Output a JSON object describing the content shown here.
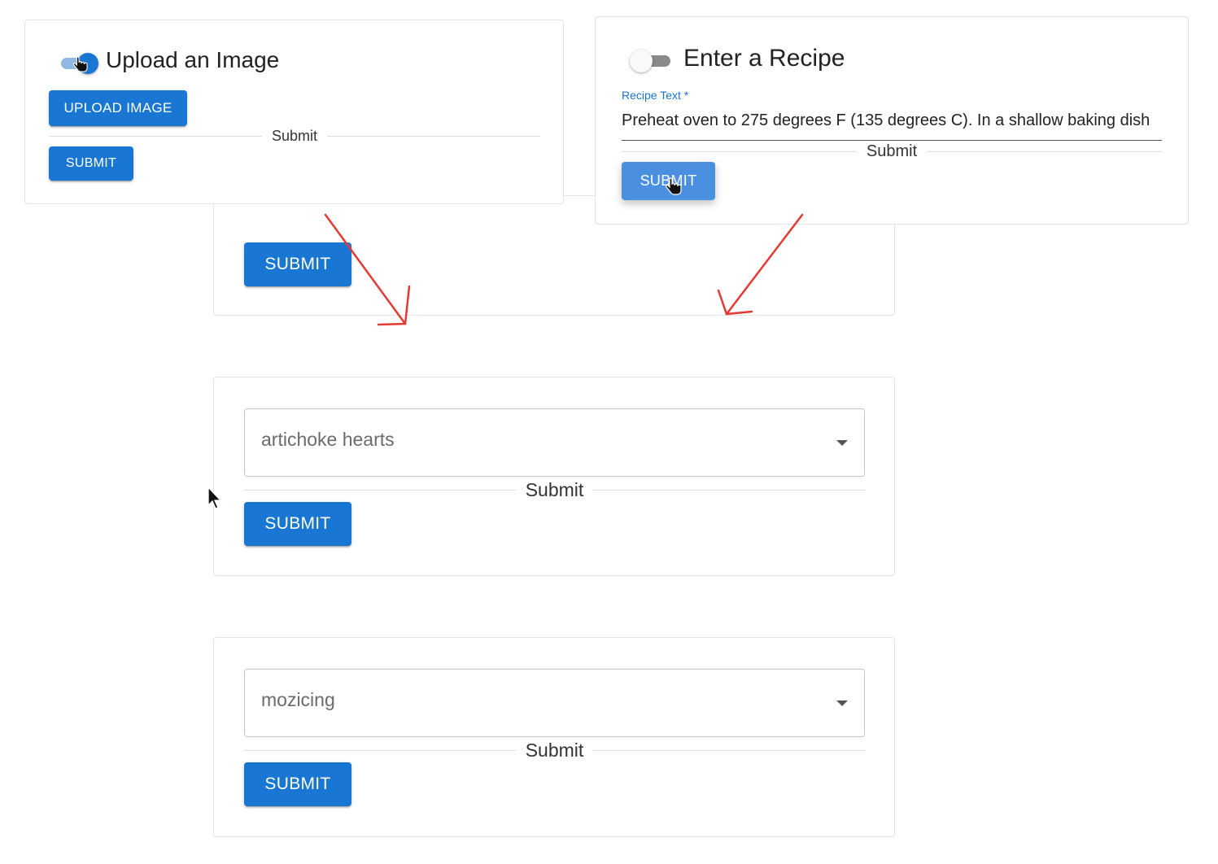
{
  "upload_card": {
    "title": "Upload an Image",
    "upload_button": "UPLOAD IMAGE",
    "divider_label": "Submit",
    "submit_button": "SUBMIT"
  },
  "recipe_card": {
    "title": "Enter a Recipe",
    "field_label": "Recipe Text *",
    "field_value": "Preheat oven to 275 degrees F (135 degrees C). In a shallow baking dish",
    "divider_label": "Submit",
    "submit_button": "SUBMIT"
  },
  "partial_card": {
    "submit_button": "SUBMIT"
  },
  "ingredient_card_1": {
    "select_value": "artichoke hearts",
    "divider_label": "Submit",
    "submit_button": "SUBMIT"
  },
  "ingredient_card_2": {
    "select_value": "mozicing",
    "divider_label": "Submit",
    "submit_button": "SUBMIT"
  },
  "colors": {
    "primary": "#1976d2",
    "annotation_arrow": "#e53935"
  }
}
